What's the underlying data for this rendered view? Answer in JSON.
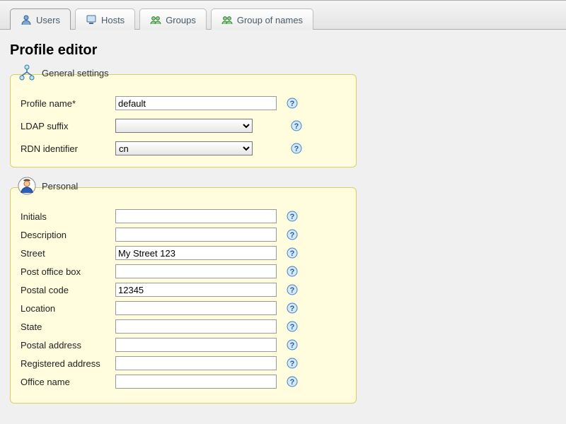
{
  "tabs": [
    {
      "label": "Users",
      "icon": "user-icon"
    },
    {
      "label": "Hosts",
      "icon": "host-icon"
    },
    {
      "label": "Groups",
      "icon": "group-icon"
    },
    {
      "label": "Group of names",
      "icon": "group-names-icon"
    }
  ],
  "page_title": "Profile editor",
  "general": {
    "legend": "General settings",
    "profile_name": {
      "label": "Profile name*",
      "value": "default"
    },
    "ldap_suffix": {
      "label": "LDAP suffix",
      "value": ""
    },
    "rdn": {
      "label": "RDN identifier",
      "value": "cn"
    }
  },
  "personal": {
    "legend": "Personal",
    "fields": [
      {
        "key": "initials",
        "label": "Initials",
        "value": ""
      },
      {
        "key": "description",
        "label": "Description",
        "value": ""
      },
      {
        "key": "street",
        "label": "Street",
        "value": "My Street 123"
      },
      {
        "key": "post_office_box",
        "label": "Post office box",
        "value": ""
      },
      {
        "key": "postal_code",
        "label": "Postal code",
        "value": "12345"
      },
      {
        "key": "location",
        "label": "Location",
        "value": ""
      },
      {
        "key": "state",
        "label": "State",
        "value": ""
      },
      {
        "key": "postal_address",
        "label": "Postal address",
        "value": ""
      },
      {
        "key": "registered_address",
        "label": "Registered address",
        "value": ""
      },
      {
        "key": "office_name",
        "label": "Office name",
        "value": ""
      }
    ]
  }
}
